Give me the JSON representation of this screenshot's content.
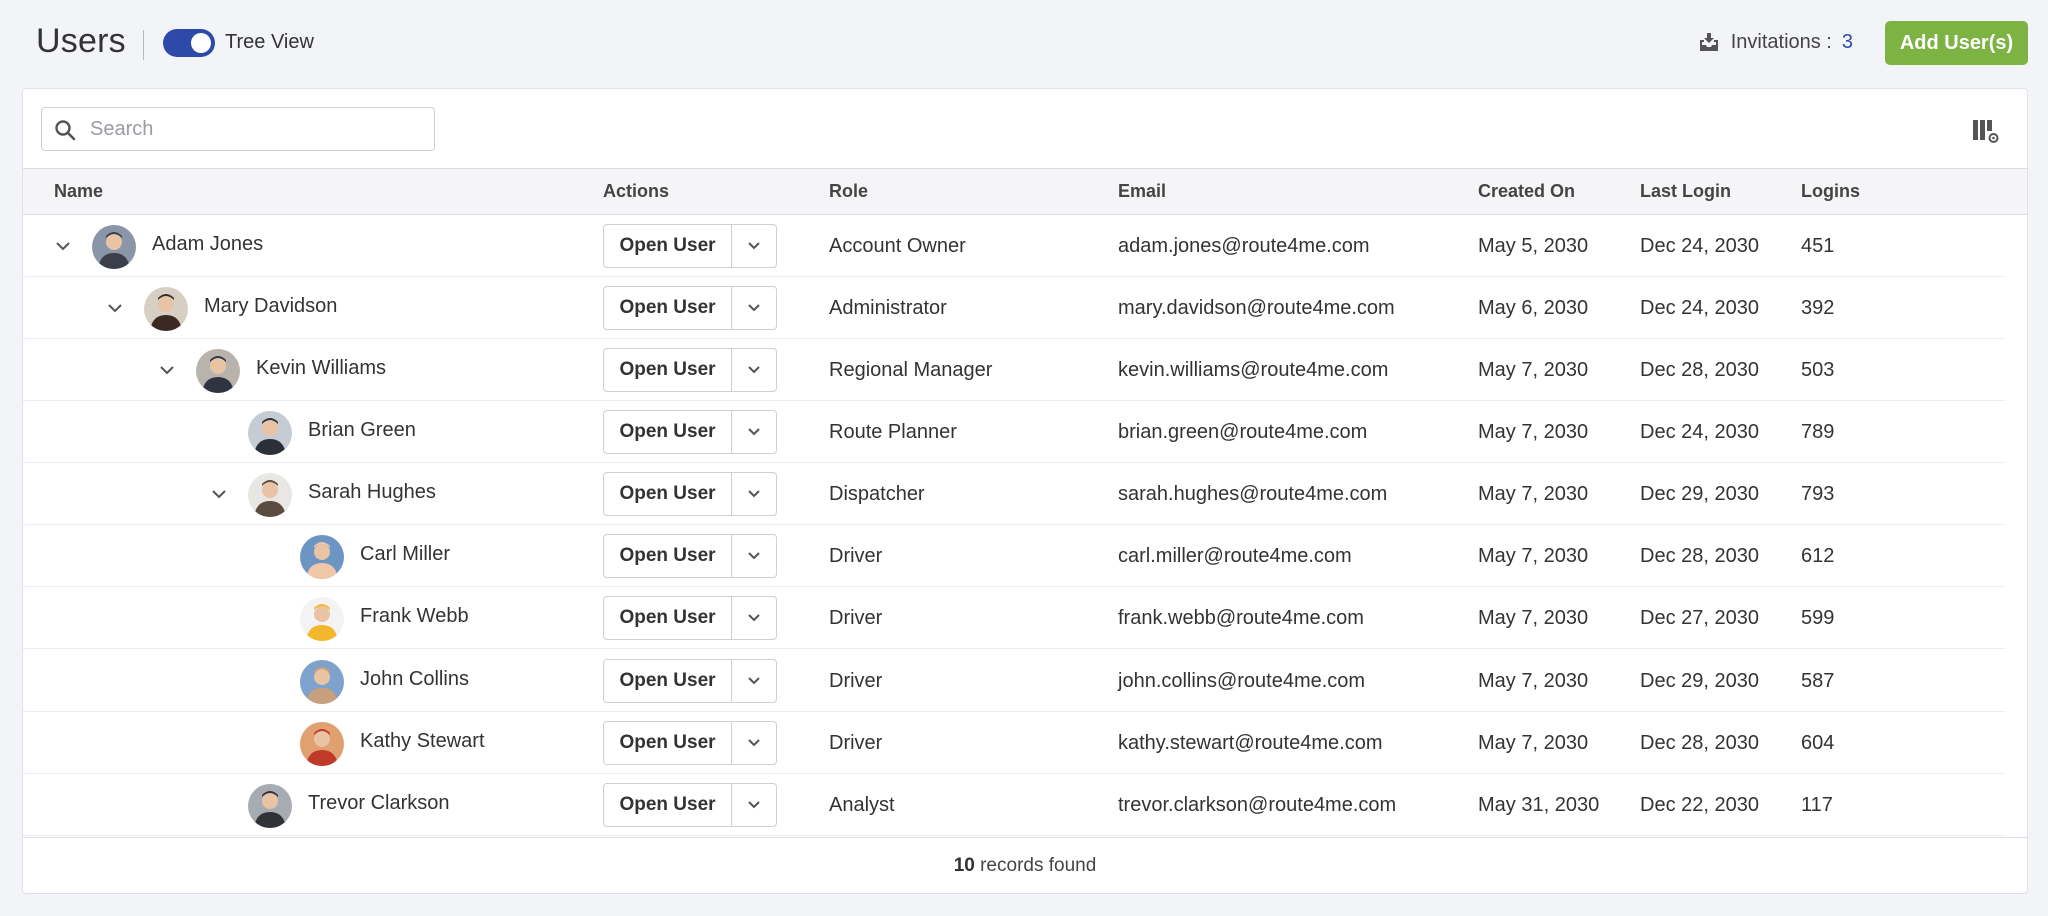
{
  "header": {
    "title": "Users",
    "tree_view_label": "Tree View",
    "tree_view_on": true,
    "invitations_label": "Invitations :",
    "invitations_count": "3",
    "add_button_label": "Add User(s)",
    "accent_color": "#2d4aa8",
    "add_button_color": "#7cb342"
  },
  "search": {
    "placeholder": "Search",
    "value": ""
  },
  "table": {
    "columns": [
      "Name",
      "Actions",
      "Role",
      "Email",
      "Created On",
      "Last Login",
      "Logins"
    ],
    "action_label": "Open User",
    "rows": [
      {
        "name": "Adam Jones",
        "level": 0,
        "expandable": true,
        "role": "Account Owner",
        "email": "adam.jones@route4me.com",
        "created": "May 5, 2030",
        "last_login": "Dec 24, 2030",
        "logins": "451",
        "avatar_bg": "#8a96a8",
        "avatar_fg": "#3a3f4a"
      },
      {
        "name": "Mary Davidson",
        "level": 1,
        "expandable": true,
        "role": "Administrator",
        "email": "mary.davidson@route4me.com",
        "created": "May 6, 2030",
        "last_login": "Dec 24, 2030",
        "logins": "392",
        "avatar_bg": "#d8cfc4",
        "avatar_fg": "#3b2a22"
      },
      {
        "name": "Kevin Williams",
        "level": 2,
        "expandable": true,
        "role": "Regional Manager",
        "email": "kevin.williams@route4me.com",
        "created": "May 7, 2030",
        "last_login": "Dec 28, 2030",
        "logins": "503",
        "avatar_bg": "#b9b3ad",
        "avatar_fg": "#2e3440"
      },
      {
        "name": "Brian Green",
        "level": 3,
        "expandable": false,
        "role": "Route Planner",
        "email": "brian.green@route4me.com",
        "created": "May 7, 2030",
        "last_login": "Dec 24, 2030",
        "logins": "789",
        "avatar_bg": "#c6ccd4",
        "avatar_fg": "#2b2f36"
      },
      {
        "name": "Sarah Hughes",
        "level": 3,
        "expandable": true,
        "role": "Dispatcher",
        "email": "sarah.hughes@route4me.com",
        "created": "May 7, 2030",
        "last_login": "Dec 29, 2030",
        "logins": "793",
        "avatar_bg": "#e9e7e4",
        "avatar_fg": "#5a4a3f"
      },
      {
        "name": "Carl Miller",
        "level": 4,
        "expandable": false,
        "role": "Driver",
        "email": "carl.miller@route4me.com",
        "created": "May 7, 2030",
        "last_login": "Dec 28, 2030",
        "logins": "612",
        "avatar_bg": "#6d95c4",
        "avatar_fg": "#f0c8a8"
      },
      {
        "name": "Frank Webb",
        "level": 4,
        "expandable": false,
        "role": "Driver",
        "email": "frank.webb@route4me.com",
        "created": "May 7, 2030",
        "last_login": "Dec 27, 2030",
        "logins": "599",
        "avatar_bg": "#f3f3f3",
        "avatar_fg": "#f2b72a"
      },
      {
        "name": "John Collins",
        "level": 4,
        "expandable": false,
        "role": "Driver",
        "email": "john.collins@route4me.com",
        "created": "May 7, 2030",
        "last_login": "Dec 29, 2030",
        "logins": "587",
        "avatar_bg": "#7ea2cc",
        "avatar_fg": "#c9a07c"
      },
      {
        "name": "Kathy Stewart",
        "level": 4,
        "expandable": false,
        "role": "Driver",
        "email": "kathy.stewart@route4me.com",
        "created": "May 7, 2030",
        "last_login": "Dec 28, 2030",
        "logins": "604",
        "avatar_bg": "#e0a070",
        "avatar_fg": "#c0392b"
      },
      {
        "name": "Trevor Clarkson",
        "level": 3,
        "expandable": false,
        "role": "Analyst",
        "email": "trevor.clarkson@route4me.com",
        "created": "May 31, 2030",
        "last_login": "Dec 22, 2030",
        "logins": "117",
        "avatar_bg": "#a7abb2",
        "avatar_fg": "#2f3238"
      }
    ]
  },
  "footer": {
    "count": "10",
    "suffix": " records found"
  }
}
